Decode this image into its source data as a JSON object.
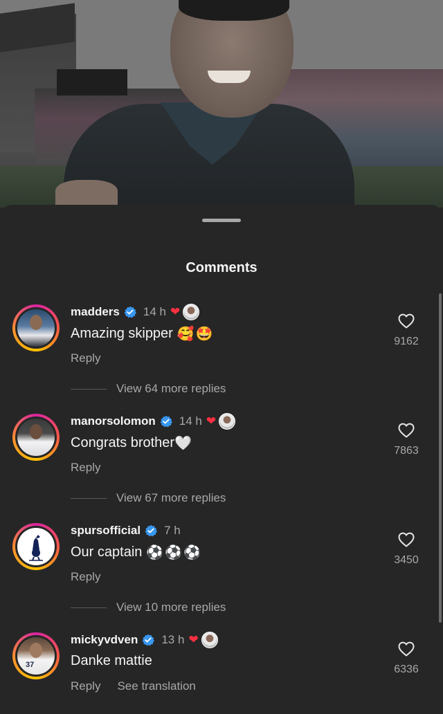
{
  "sheet": {
    "title": "Comments"
  },
  "colors": {
    "background": "#262626",
    "primary_text": "#f5f5f5",
    "secondary_text": "#a8a8a8",
    "verified_blue": "#3897f0",
    "like_red": "#ff3040"
  },
  "comments": [
    {
      "username": "madders",
      "verified": true,
      "time": "14 h",
      "liked_by_author": true,
      "text": "Amazing skipper",
      "emojis": [
        "🥰",
        "🤩"
      ],
      "reply_label": "Reply",
      "like_count": "9162",
      "view_replies": "View 64 more replies",
      "avatar": "madders-avatar"
    },
    {
      "username": "manorsolomon",
      "verified": true,
      "time": "14 h",
      "liked_by_author": true,
      "text": "Congrats brother",
      "emojis": [
        "🤍"
      ],
      "reply_label": "Reply",
      "like_count": "7863",
      "view_replies": "View 67 more replies",
      "avatar": "manorsolomon-avatar"
    },
    {
      "username": "spursofficial",
      "verified": true,
      "time": "7 h",
      "liked_by_author": false,
      "text": "Our captain",
      "emojis": [
        "⚽",
        "⚽",
        "⚽"
      ],
      "reply_label": "Reply",
      "like_count": "3450",
      "view_replies": "View 10 more replies",
      "avatar": "spurs-crest-avatar"
    },
    {
      "username": "mickyvdven",
      "verified": true,
      "time": "13 h",
      "liked_by_author": true,
      "text": "Danke mattie",
      "emojis": [],
      "reply_label": "Reply",
      "see_translation": "See translation",
      "like_count": "6336",
      "avatar": "mickyvdven-avatar",
      "avatar_number": "37"
    }
  ]
}
